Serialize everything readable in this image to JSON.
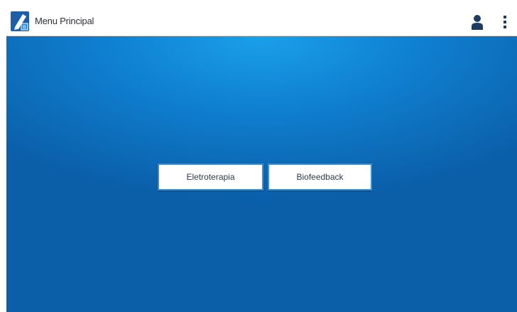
{
  "app": {
    "title": "Menu Principal",
    "icon": "app-logo-icon"
  },
  "toolbar": {
    "user_icon": "user-icon",
    "overflow_icon": "more-vert-icon"
  },
  "main": {
    "buttons": [
      {
        "label": "Eletroterapia"
      },
      {
        "label": "Biofeedback"
      }
    ]
  },
  "colors": {
    "background_top": "#1aa0e8",
    "background_bottom": "#0b5ea8",
    "button_border": "#3e8fd0",
    "icon_dark": "#1f3d63"
  }
}
